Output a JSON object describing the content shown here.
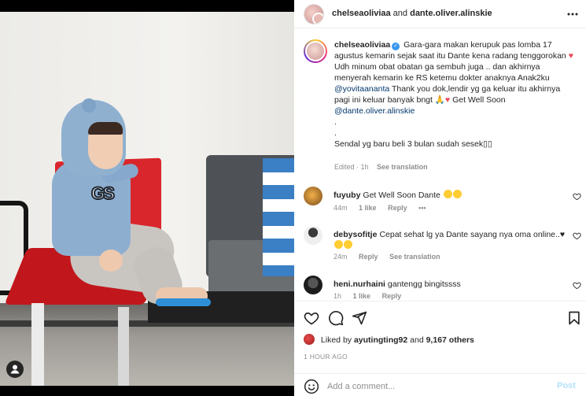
{
  "colors": {
    "accent": "#0095f6",
    "link": "#00376b",
    "heart": "#ed4956",
    "meta": "#8e8e8e"
  },
  "header": {
    "user1": "chelseaoliviaa",
    "joiner": "and",
    "user2": "dante.oliver.alinskie",
    "more_icon": "more-horizontal-icon"
  },
  "caption": {
    "user": "chelseaoliviaa",
    "line1": "Gara-gara makan kerupuk pas lomba 17 agustus kemarin sejak saat itu Dante kena radang tenggorokan",
    "line2a": "Udh minum obat obatan ga sembuh juga .. dan akhirnya menyerah kemarin ke RS ketemu dokter anaknya Anak2ku",
    "mention1": "@yovitaananta",
    "line2b": "Thank you dok,lendir yg ga keluar itu akhirnya pagi ini keluar banyak bngt",
    "line2c": "Get Well Soon",
    "mention2": "@dante.oliver.alinskie",
    "dot1": ".",
    "dot2": ".",
    "line3": "Sendal yg baru beli 3 bulan sudah sesek",
    "edited": "Edited · 1h",
    "see_translation": "See translation"
  },
  "comments": [
    {
      "user": "fuyuby",
      "text": "Get Well Soon Dante",
      "time": "44m",
      "likes": "1 like",
      "reply": "Reply",
      "extra": "•••"
    },
    {
      "user": "debysofitje",
      "text": "Cepat sehat lg ya Dante sayang nya oma online..",
      "time": "24m",
      "reply": "Reply",
      "extra": "See translation"
    },
    {
      "user": "heni.nurhaini",
      "text": "gantengg bingitssss",
      "time": "1h",
      "likes": "1 like",
      "reply": "Reply"
    }
  ],
  "likes": {
    "prefix": "Liked by",
    "user": "ayutingting92",
    "joiner": "and",
    "count": "9,167 others"
  },
  "timestamp": "1 HOUR AGO",
  "add_comment": {
    "placeholder": "Add a comment...",
    "post_label": "Post"
  }
}
